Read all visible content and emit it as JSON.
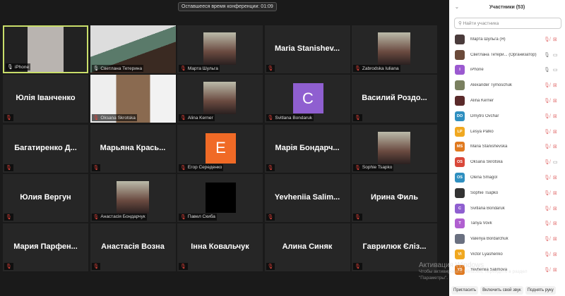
{
  "timer": "Оставшееся время конференции: 01:09",
  "tiles": [
    {
      "name": "iPhone",
      "kind": "video",
      "selected": true,
      "muted": false
    },
    {
      "name": "Светлана Тетерина",
      "kind": "video",
      "muted": false
    },
    {
      "name": "Марта Шульга",
      "kind": "photo",
      "muted": true
    },
    {
      "name": "Maria  Stanishev...",
      "kind": "text",
      "muted": true
    },
    {
      "name": "Zabrodska Iuliana",
      "kind": "photo",
      "muted": true
    },
    {
      "name": "Юлія Іванченко",
      "kind": "text",
      "muted": true
    },
    {
      "name": "Oksana Skrotska",
      "kind": "video",
      "muted": true
    },
    {
      "name": "Alina Kerner",
      "kind": "photo",
      "muted": true
    },
    {
      "name": "Svitlana Bondaruk",
      "kind": "avatar",
      "letter": "C",
      "color": "#8f5fd0",
      "muted": true
    },
    {
      "name": "Василий  Роздо...",
      "kind": "text",
      "muted": true
    },
    {
      "name": "Багатиренко  Д...",
      "kind": "text",
      "muted": true
    },
    {
      "name": "Марьяна  Крась...",
      "kind": "text",
      "muted": true
    },
    {
      "name": "Егор Середенко",
      "kind": "avatar",
      "letter": "E",
      "color": "#f06a26",
      "muted": true
    },
    {
      "name": "Марія  Бондарч...",
      "kind": "text",
      "muted": true
    },
    {
      "name": "Sophie Tsapko",
      "kind": "photo",
      "muted": true
    },
    {
      "name": "Юлия  Вергун",
      "kind": "text",
      "muted": true
    },
    {
      "name": "Анастасія Бондарчук",
      "kind": "photo",
      "muted": true
    },
    {
      "name": "Павел Скиба",
      "kind": "black",
      "muted": true
    },
    {
      "name": "Yevheniia  Salim...",
      "kind": "text",
      "muted": true
    },
    {
      "name": "Ирина  Филь",
      "kind": "text",
      "muted": true
    },
    {
      "name": "Мария  Парфен...",
      "kind": "text",
      "muted": true
    },
    {
      "name": "Анастасія  Возна",
      "kind": "text",
      "muted": true
    },
    {
      "name": "Інна  Ковальчук",
      "kind": "text",
      "muted": true
    },
    {
      "name": "Алина  Синяк",
      "kind": "text",
      "muted": true
    },
    {
      "name": "Гаврилюк  Єліз...",
      "kind": "text",
      "muted": true
    }
  ],
  "panel": {
    "title": "Участники (53)",
    "search_placeholder": "Найти участника",
    "participants": [
      {
        "name": "Марта Шульга (Я)",
        "initials": "",
        "color": "#4a3b3b",
        "mic": "off",
        "cam": "off"
      },
      {
        "name": "Светлана Тетери...  (Организатор)",
        "initials": "",
        "color": "#6b4a3a",
        "mic": "on",
        "cam": "on"
      },
      {
        "name": "iPhone",
        "initials": "I",
        "color": "#9b59d0",
        "mic": "on",
        "cam": "on"
      },
      {
        "name": "Alexander Tymoschuk",
        "initials": "",
        "color": "#7a8060",
        "mic": "off",
        "cam": "off"
      },
      {
        "name": "Alina Kerner",
        "initials": "",
        "color": "#5a2a2a",
        "mic": "off",
        "cam": "off"
      },
      {
        "name": "Dmytro Ovchar",
        "initials": "DO",
        "color": "#2f8fc0",
        "mic": "off",
        "cam": "off"
      },
      {
        "name": "Lesya Palko",
        "initials": "LP",
        "color": "#f0a820",
        "mic": "off",
        "cam": "off"
      },
      {
        "name": "Maria Stanishevska",
        "initials": "MS",
        "color": "#e07a20",
        "mic": "off",
        "cam": "off"
      },
      {
        "name": "Oksana Skrotska",
        "initials": "OS",
        "color": "#d9483a",
        "mic": "off",
        "cam": "on"
      },
      {
        "name": "Olena Smagol",
        "initials": "OS",
        "color": "#2f8fc0",
        "mic": "off",
        "cam": "off"
      },
      {
        "name": "Sophie Tsapko",
        "initials": "",
        "color": "#333333",
        "mic": "off",
        "cam": "off"
      },
      {
        "name": "Svitlana Bondaruk",
        "initials": "C",
        "color": "#8f5fd0",
        "mic": "off",
        "cam": "off"
      },
      {
        "name": "Tanya Vovk",
        "initials": "T",
        "color": "#b05fd0",
        "mic": "off",
        "cam": "off"
      },
      {
        "name": "Valeriya Bordarchuk",
        "initials": "",
        "color": "#6a7080",
        "mic": "off",
        "cam": "off"
      },
      {
        "name": "Victor Lyashenko",
        "initials": "VI",
        "color": "#f0a820",
        "mic": "off",
        "cam": "off"
      },
      {
        "name": "Yevheniia Salimova",
        "initials": "YS",
        "color": "#e07a20",
        "mic": "off",
        "cam": "off"
      }
    ],
    "buttons": [
      "Пригласить",
      "Включить свой звук",
      "Поднять руку"
    ]
  },
  "watermark": {
    "title": "Активация Windows",
    "line1": "Чтобы активировать Windows, перейдите в раздел",
    "line2": "\"Параметры\"."
  },
  "colors": {
    "selected_border": "#c9de6a",
    "muted": "#e0433a"
  }
}
